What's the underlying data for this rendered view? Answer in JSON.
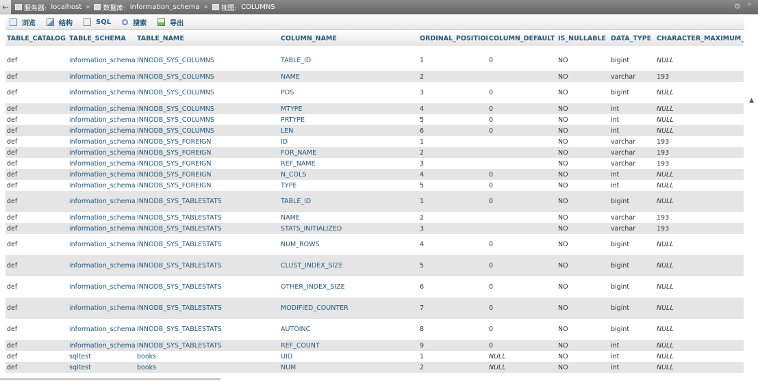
{
  "breadcrumb": {
    "server_label": "服务器:",
    "server_value": "localhost",
    "db_label": "数据库:",
    "db_value": "information_schema",
    "view_label": "视图:",
    "view_value": "COLUMNS",
    "separator": "»"
  },
  "tabs": [
    {
      "label": "浏览",
      "icon": "browse-icon"
    },
    {
      "label": "结构",
      "icon": "structure-icon"
    },
    {
      "label": "SQL",
      "icon": "sql-icon"
    },
    {
      "label": "搜索",
      "icon": "search-icon"
    },
    {
      "label": "导出",
      "icon": "export-icon"
    }
  ],
  "columns": [
    "TABLE_CATALOG",
    "TABLE_SCHEMA",
    "TABLE_NAME",
    "COLUMN_NAME",
    "ORDINAL_POSITION",
    "COLUMN_DEFAULT",
    "IS_NULLABLE",
    "DATA_TYPE",
    "CHARACTER_MAXIMUM_LE"
  ],
  "rows": [
    {
      "tall": true,
      "cells": [
        "def",
        "information_schema",
        "INNODB_SYS_COLUMNS",
        "TABLE_ID",
        "1",
        "0",
        "NO",
        "bigint",
        "NULL"
      ]
    },
    {
      "tall": false,
      "cells": [
        "def",
        "information_schema",
        "INNODB_SYS_COLUMNS",
        "NAME",
        "2",
        "",
        "NO",
        "varchar",
        "193"
      ]
    },
    {
      "tall": true,
      "cells": [
        "def",
        "information_schema",
        "INNODB_SYS_COLUMNS",
        "POS",
        "3",
        "0",
        "NO",
        "bigint",
        "NULL"
      ]
    },
    {
      "tall": false,
      "cells": [
        "def",
        "information_schema",
        "INNODB_SYS_COLUMNS",
        "MTYPE",
        "4",
        "0",
        "NO",
        "int",
        "NULL"
      ]
    },
    {
      "tall": false,
      "cells": [
        "def",
        "information_schema",
        "INNODB_SYS_COLUMNS",
        "PRTYPE",
        "5",
        "0",
        "NO",
        "int",
        "NULL"
      ]
    },
    {
      "tall": false,
      "cells": [
        "def",
        "information_schema",
        "INNODB_SYS_COLUMNS",
        "LEN",
        "6",
        "0",
        "NO",
        "int",
        "NULL"
      ]
    },
    {
      "tall": false,
      "cells": [
        "def",
        "information_schema",
        "INNODB_SYS_FOREIGN",
        "ID",
        "1",
        "",
        "NO",
        "varchar",
        "193"
      ]
    },
    {
      "tall": false,
      "cells": [
        "def",
        "information_schema",
        "INNODB_SYS_FOREIGN",
        "FOR_NAME",
        "2",
        "",
        "NO",
        "varchar",
        "193"
      ]
    },
    {
      "tall": false,
      "cells": [
        "def",
        "information_schema",
        "INNODB_SYS_FOREIGN",
        "REF_NAME",
        "3",
        "",
        "NO",
        "varchar",
        "193"
      ]
    },
    {
      "tall": false,
      "cells": [
        "def",
        "information_schema",
        "INNODB_SYS_FOREIGN",
        "N_COLS",
        "4",
        "0",
        "NO",
        "int",
        "NULL"
      ]
    },
    {
      "tall": false,
      "cells": [
        "def",
        "information_schema",
        "INNODB_SYS_FOREIGN",
        "TYPE",
        "5",
        "0",
        "NO",
        "int",
        "NULL"
      ]
    },
    {
      "tall": true,
      "cells": [
        "def",
        "information_schema",
        "INNODB_SYS_TABLESTATS",
        "TABLE_ID",
        "1",
        "0",
        "NO",
        "bigint",
        "NULL"
      ]
    },
    {
      "tall": false,
      "cells": [
        "def",
        "information_schema",
        "INNODB_SYS_TABLESTATS",
        "NAME",
        "2",
        "",
        "NO",
        "varchar",
        "193"
      ]
    },
    {
      "tall": false,
      "cells": [
        "def",
        "information_schema",
        "INNODB_SYS_TABLESTATS",
        "STATS_INITIALIZED",
        "3",
        "",
        "NO",
        "varchar",
        "193"
      ]
    },
    {
      "tall": true,
      "cells": [
        "def",
        "information_schema",
        "INNODB_SYS_TABLESTATS",
        "NUM_ROWS",
        "4",
        "0",
        "NO",
        "bigint",
        "NULL"
      ]
    },
    {
      "tall": true,
      "cells": [
        "def",
        "information_schema",
        "INNODB_SYS_TABLESTATS",
        "CLUST_INDEX_SIZE",
        "5",
        "0",
        "NO",
        "bigint",
        "NULL"
      ]
    },
    {
      "tall": true,
      "cells": [
        "def",
        "information_schema",
        "INNODB_SYS_TABLESTATS",
        "OTHER_INDEX_SIZE",
        "6",
        "0",
        "NO",
        "bigint",
        "NULL"
      ]
    },
    {
      "tall": true,
      "cells": [
        "def",
        "information_schema",
        "INNODB_SYS_TABLESTATS",
        "MODIFIED_COUNTER",
        "7",
        "0",
        "NO",
        "bigint",
        "NULL"
      ]
    },
    {
      "tall": true,
      "cells": [
        "def",
        "information_schema",
        "INNODB_SYS_TABLESTATS",
        "AUTOINC",
        "8",
        "0",
        "NO",
        "bigint",
        "NULL"
      ]
    },
    {
      "tall": false,
      "cells": [
        "def",
        "information_schema",
        "INNODB_SYS_TABLESTATS",
        "REF_COUNT",
        "9",
        "0",
        "NO",
        "int",
        "NULL"
      ]
    },
    {
      "tall": false,
      "cells": [
        "def",
        "sqltest",
        "books",
        "UID",
        "1",
        "NULL",
        "NO",
        "int",
        "NULL"
      ]
    },
    {
      "tall": false,
      "cells": [
        "def",
        "sqltest",
        "books",
        "NUM",
        "2",
        "NULL",
        "NO",
        "int",
        "NULL"
      ]
    }
  ]
}
